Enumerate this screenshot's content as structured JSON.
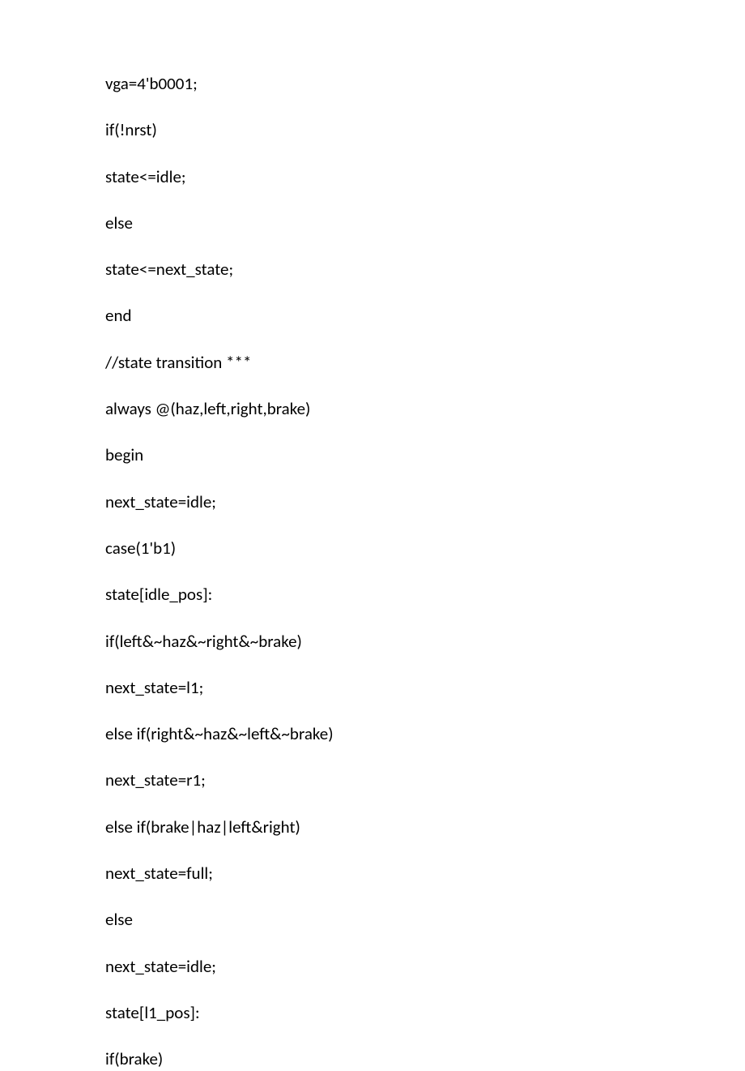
{
  "lines": [
    "vga=4'b0001;",
    "if(!nrst)",
    "state<=idle;",
    "else",
    "state<=next_state;",
    "end",
    "//state transition ***",
    "always @(haz,left,right,brake)",
    "begin",
    "next_state=idle;",
    "case(1'b1)",
    "state[idle_pos]:",
    "if(left&~haz&~right&~brake)",
    "next_state=l1;",
    "else if(right&~haz&~left&~brake)",
    "next_state=r1;",
    "else if(brake|haz|left&right)",
    "next_state=full;",
    "else",
    "next_state=idle;",
    "state[l1_pos]:",
    "if(brake)"
  ]
}
